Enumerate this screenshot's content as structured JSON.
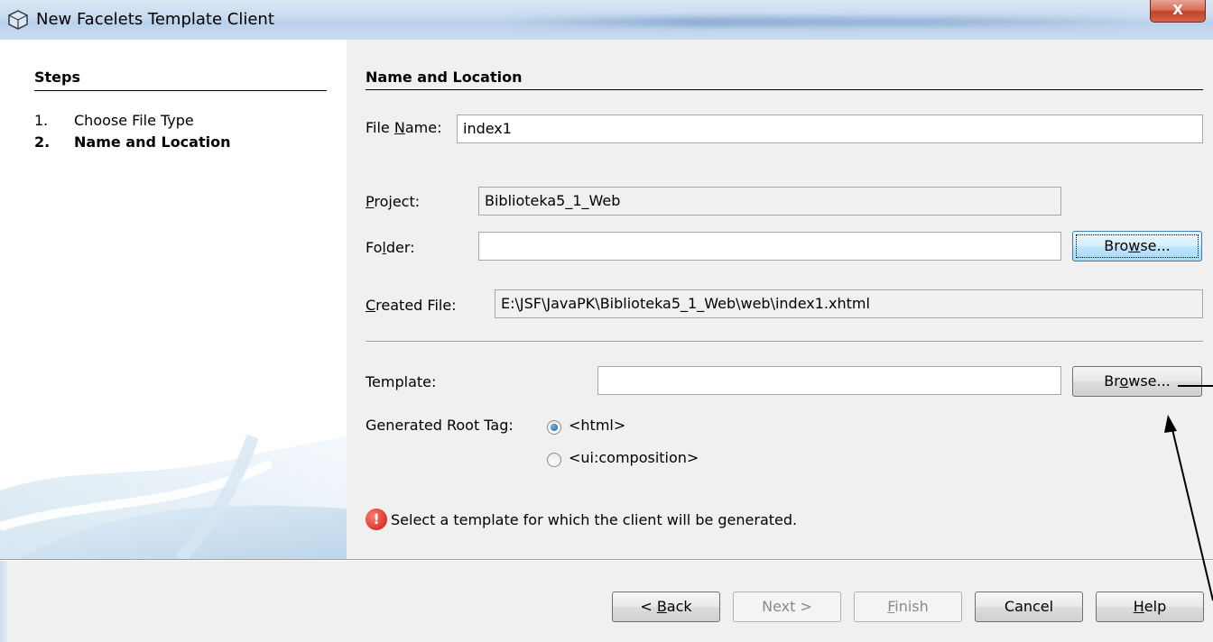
{
  "window": {
    "title": "New Facelets Template Client",
    "close_label": "X"
  },
  "steps": {
    "title": "Steps",
    "items": [
      {
        "num": "1.",
        "label": "Choose File Type",
        "current": false
      },
      {
        "num": "2.",
        "label": "Name and Location",
        "current": true
      }
    ]
  },
  "form": {
    "section_title": "Name and Location",
    "file_name_label": {
      "before": "File ",
      "mnemonic": "N",
      "after": "ame:"
    },
    "file_name_value": "index1",
    "project_label": {
      "before": "",
      "mnemonic": "P",
      "after": "roject:"
    },
    "project_value": "Biblioteka5_1_Web",
    "folder_label": {
      "before": "Fo",
      "mnemonic": "l",
      "after": "der:"
    },
    "folder_value": "",
    "folder_browse": {
      "before": "Bro",
      "mnemonic": "w",
      "after": "se..."
    },
    "created_file_label": {
      "before": "",
      "mnemonic": "C",
      "after": "reated File:"
    },
    "created_file_value": "E:\\JSF\\JavaPK\\Biblioteka5_1_Web\\web\\index1.xhtml",
    "template_label": "Template:",
    "template_value": "",
    "template_browse": {
      "before": "Br",
      "mnemonic": "o",
      "after": "wse..."
    },
    "root_tag_label": "Generated Root Tag:",
    "root_tag_options": [
      "<html>",
      "<ui:composition>"
    ],
    "root_tag_selected": "<html>",
    "error_message": "Select a template for which the client will be generated.",
    "error_icon_glyph": "!"
  },
  "buttons": {
    "back": {
      "before": "< ",
      "mnemonic": "B",
      "after": "ack"
    },
    "next": "Next >",
    "finish": {
      "before": "",
      "mnemonic": "F",
      "after": "inish"
    },
    "cancel": "Cancel",
    "help": {
      "before": "",
      "mnemonic": "H",
      "after": "elp"
    }
  },
  "colors": {
    "error": "#c8180c",
    "focus_button": "#bee6fd",
    "titlebar": "#c7daee"
  }
}
